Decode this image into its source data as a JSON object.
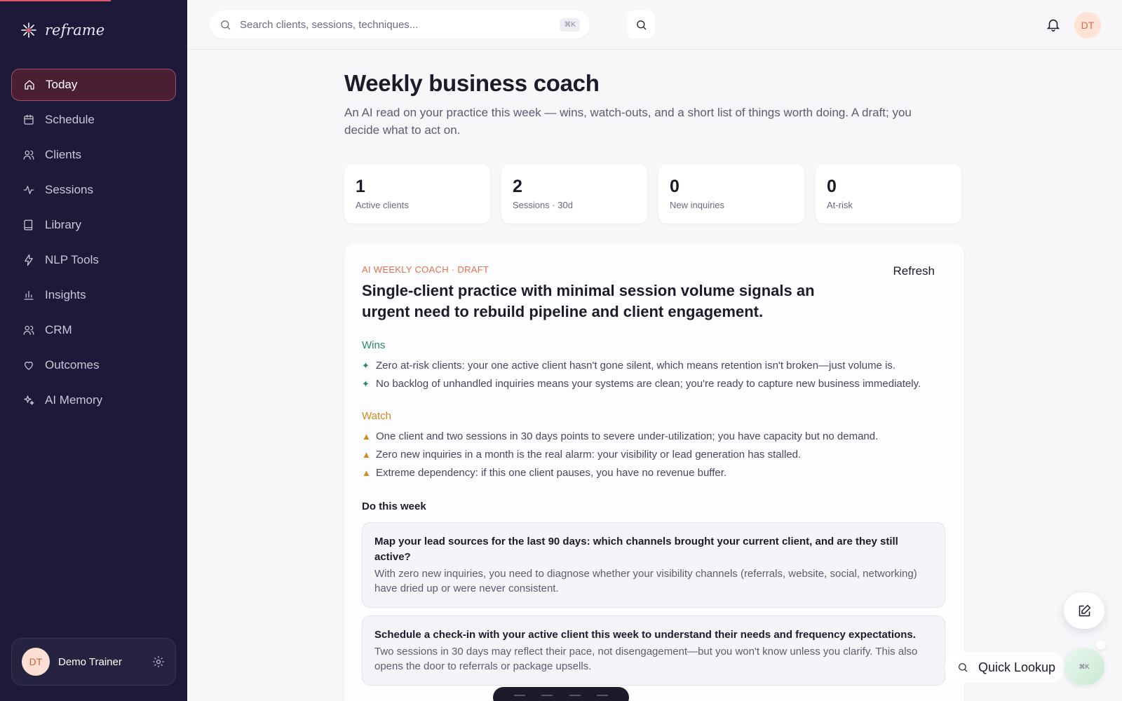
{
  "app": {
    "name": "reframe"
  },
  "sidebar": {
    "items": [
      {
        "label": "Today",
        "icon": "home-icon",
        "active": true
      },
      {
        "label": "Schedule",
        "icon": "calendar-icon"
      },
      {
        "label": "Clients",
        "icon": "users-icon"
      },
      {
        "label": "Sessions",
        "icon": "activity-icon"
      },
      {
        "label": "Library",
        "icon": "book-icon"
      },
      {
        "label": "NLP Tools",
        "icon": "lightning-icon"
      },
      {
        "label": "Insights",
        "icon": "bar-chart-icon"
      },
      {
        "label": "CRM",
        "icon": "users-icon"
      },
      {
        "label": "Outcomes",
        "icon": "heart-icon"
      },
      {
        "label": "AI Memory",
        "icon": "sparkles-icon"
      }
    ],
    "user": {
      "initials": "DT",
      "name": "Demo Trainer"
    }
  },
  "topbar": {
    "search_placeholder": "Search clients, sessions, techniques...",
    "shortcut": "⌘K",
    "avatar_initials": "DT"
  },
  "page": {
    "title": "Weekly business coach",
    "subtitle": "An AI read on your practice this week — wins, watch-outs, and a short list of things worth doing. A draft; you decide what to act on."
  },
  "stats": [
    {
      "value": "1",
      "label": "Active clients"
    },
    {
      "value": "2",
      "label": "Sessions · 30d"
    },
    {
      "value": "0",
      "label": "New inquiries"
    },
    {
      "value": "0",
      "label": "At-risk"
    }
  ],
  "coach": {
    "eyebrow": "AI WEEKLY COACH · DRAFT",
    "refresh_label": "Refresh",
    "headline": "Single-client practice with minimal session volume signals an urgent need to rebuild pipeline and client engagement.",
    "wins_title": "Wins",
    "wins": [
      "Zero at-risk clients: your one active client hasn't gone silent, which means retention isn't broken—just volume is.",
      "No backlog of unhandled inquiries means your systems are clean; you're ready to capture new business immediately."
    ],
    "watch_title": "Watch",
    "watch": [
      "One client and two sessions in 30 days points to severe under-utilization; you have capacity but no demand.",
      "Zero new inquiries in a month is the real alarm: your visibility or lead generation has stalled.",
      "Extreme dependency: if this one client pauses, you have no revenue buffer."
    ],
    "do_title": "Do this week",
    "tasks": [
      {
        "title": "Map your lead sources for the last 90 days: which channels brought your current client, and are they still active?",
        "desc": "With zero new inquiries, you need to diagnose whether your visibility channels (referrals, website, social, networking) have dried up or were never consistent."
      },
      {
        "title": "Schedule a check-in with your active client this week to understand their needs and frequency expectations.",
        "desc": "Two sessions in 30 days may reflect their pace, not disengagement—but you won't know unless you clarify. This also opens the door to referrals or package upsells."
      }
    ]
  },
  "floating": {
    "quick_lookup": "Quick Lookup",
    "quick_shortcut": "⌘K"
  },
  "colors": {
    "sidebar": "#1c1a38",
    "accent": "#e0724f",
    "win": "#2a8a5f",
    "watch": "#c98a1a"
  }
}
